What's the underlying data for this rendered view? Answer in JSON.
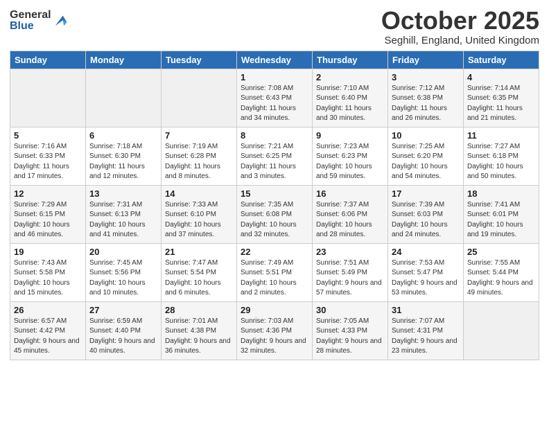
{
  "logo": {
    "general": "General",
    "blue": "Blue"
  },
  "title": "October 2025",
  "location": "Seghill, England, United Kingdom",
  "days_header": [
    "Sunday",
    "Monday",
    "Tuesday",
    "Wednesday",
    "Thursday",
    "Friday",
    "Saturday"
  ],
  "weeks": [
    [
      {
        "day": "",
        "sunrise": "",
        "sunset": "",
        "daylight": ""
      },
      {
        "day": "",
        "sunrise": "",
        "sunset": "",
        "daylight": ""
      },
      {
        "day": "",
        "sunrise": "",
        "sunset": "",
        "daylight": ""
      },
      {
        "day": "1",
        "sunrise": "Sunrise: 7:08 AM",
        "sunset": "Sunset: 6:43 PM",
        "daylight": "Daylight: 11 hours and 34 minutes."
      },
      {
        "day": "2",
        "sunrise": "Sunrise: 7:10 AM",
        "sunset": "Sunset: 6:40 PM",
        "daylight": "Daylight: 11 hours and 30 minutes."
      },
      {
        "day": "3",
        "sunrise": "Sunrise: 7:12 AM",
        "sunset": "Sunset: 6:38 PM",
        "daylight": "Daylight: 11 hours and 26 minutes."
      },
      {
        "day": "4",
        "sunrise": "Sunrise: 7:14 AM",
        "sunset": "Sunset: 6:35 PM",
        "daylight": "Daylight: 11 hours and 21 minutes."
      }
    ],
    [
      {
        "day": "5",
        "sunrise": "Sunrise: 7:16 AM",
        "sunset": "Sunset: 6:33 PM",
        "daylight": "Daylight: 11 hours and 17 minutes."
      },
      {
        "day": "6",
        "sunrise": "Sunrise: 7:18 AM",
        "sunset": "Sunset: 6:30 PM",
        "daylight": "Daylight: 11 hours and 12 minutes."
      },
      {
        "day": "7",
        "sunrise": "Sunrise: 7:19 AM",
        "sunset": "Sunset: 6:28 PM",
        "daylight": "Daylight: 11 hours and 8 minutes."
      },
      {
        "day": "8",
        "sunrise": "Sunrise: 7:21 AM",
        "sunset": "Sunset: 6:25 PM",
        "daylight": "Daylight: 11 hours and 3 minutes."
      },
      {
        "day": "9",
        "sunrise": "Sunrise: 7:23 AM",
        "sunset": "Sunset: 6:23 PM",
        "daylight": "Daylight: 10 hours and 59 minutes."
      },
      {
        "day": "10",
        "sunrise": "Sunrise: 7:25 AM",
        "sunset": "Sunset: 6:20 PM",
        "daylight": "Daylight: 10 hours and 54 minutes."
      },
      {
        "day": "11",
        "sunrise": "Sunrise: 7:27 AM",
        "sunset": "Sunset: 6:18 PM",
        "daylight": "Daylight: 10 hours and 50 minutes."
      }
    ],
    [
      {
        "day": "12",
        "sunrise": "Sunrise: 7:29 AM",
        "sunset": "Sunset: 6:15 PM",
        "daylight": "Daylight: 10 hours and 46 minutes."
      },
      {
        "day": "13",
        "sunrise": "Sunrise: 7:31 AM",
        "sunset": "Sunset: 6:13 PM",
        "daylight": "Daylight: 10 hours and 41 minutes."
      },
      {
        "day": "14",
        "sunrise": "Sunrise: 7:33 AM",
        "sunset": "Sunset: 6:10 PM",
        "daylight": "Daylight: 10 hours and 37 minutes."
      },
      {
        "day": "15",
        "sunrise": "Sunrise: 7:35 AM",
        "sunset": "Sunset: 6:08 PM",
        "daylight": "Daylight: 10 hours and 32 minutes."
      },
      {
        "day": "16",
        "sunrise": "Sunrise: 7:37 AM",
        "sunset": "Sunset: 6:06 PM",
        "daylight": "Daylight: 10 hours and 28 minutes."
      },
      {
        "day": "17",
        "sunrise": "Sunrise: 7:39 AM",
        "sunset": "Sunset: 6:03 PM",
        "daylight": "Daylight: 10 hours and 24 minutes."
      },
      {
        "day": "18",
        "sunrise": "Sunrise: 7:41 AM",
        "sunset": "Sunset: 6:01 PM",
        "daylight": "Daylight: 10 hours and 19 minutes."
      }
    ],
    [
      {
        "day": "19",
        "sunrise": "Sunrise: 7:43 AM",
        "sunset": "Sunset: 5:58 PM",
        "daylight": "Daylight: 10 hours and 15 minutes."
      },
      {
        "day": "20",
        "sunrise": "Sunrise: 7:45 AM",
        "sunset": "Sunset: 5:56 PM",
        "daylight": "Daylight: 10 hours and 10 minutes."
      },
      {
        "day": "21",
        "sunrise": "Sunrise: 7:47 AM",
        "sunset": "Sunset: 5:54 PM",
        "daylight": "Daylight: 10 hours and 6 minutes."
      },
      {
        "day": "22",
        "sunrise": "Sunrise: 7:49 AM",
        "sunset": "Sunset: 5:51 PM",
        "daylight": "Daylight: 10 hours and 2 minutes."
      },
      {
        "day": "23",
        "sunrise": "Sunrise: 7:51 AM",
        "sunset": "Sunset: 5:49 PM",
        "daylight": "Daylight: 9 hours and 57 minutes."
      },
      {
        "day": "24",
        "sunrise": "Sunrise: 7:53 AM",
        "sunset": "Sunset: 5:47 PM",
        "daylight": "Daylight: 9 hours and 53 minutes."
      },
      {
        "day": "25",
        "sunrise": "Sunrise: 7:55 AM",
        "sunset": "Sunset: 5:44 PM",
        "daylight": "Daylight: 9 hours and 49 minutes."
      }
    ],
    [
      {
        "day": "26",
        "sunrise": "Sunrise: 6:57 AM",
        "sunset": "Sunset: 4:42 PM",
        "daylight": "Daylight: 9 hours and 45 minutes."
      },
      {
        "day": "27",
        "sunrise": "Sunrise: 6:59 AM",
        "sunset": "Sunset: 4:40 PM",
        "daylight": "Daylight: 9 hours and 40 minutes."
      },
      {
        "day": "28",
        "sunrise": "Sunrise: 7:01 AM",
        "sunset": "Sunset: 4:38 PM",
        "daylight": "Daylight: 9 hours and 36 minutes."
      },
      {
        "day": "29",
        "sunrise": "Sunrise: 7:03 AM",
        "sunset": "Sunset: 4:36 PM",
        "daylight": "Daylight: 9 hours and 32 minutes."
      },
      {
        "day": "30",
        "sunrise": "Sunrise: 7:05 AM",
        "sunset": "Sunset: 4:33 PM",
        "daylight": "Daylight: 9 hours and 28 minutes."
      },
      {
        "day": "31",
        "sunrise": "Sunrise: 7:07 AM",
        "sunset": "Sunset: 4:31 PM",
        "daylight": "Daylight: 9 hours and 23 minutes."
      },
      {
        "day": "",
        "sunrise": "",
        "sunset": "",
        "daylight": ""
      }
    ]
  ]
}
